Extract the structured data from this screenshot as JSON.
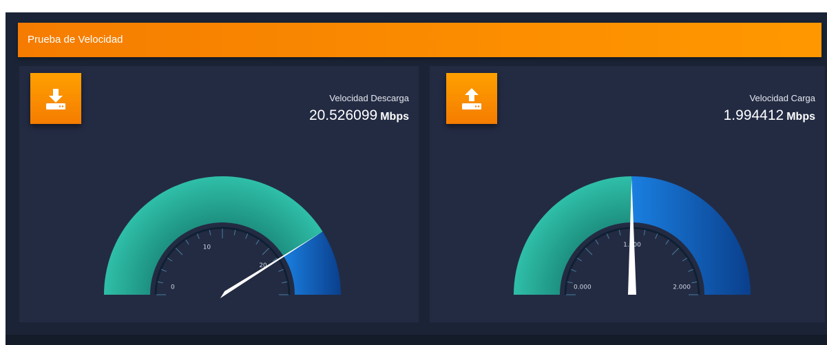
{
  "header": {
    "title": "Prueba de Velocidad"
  },
  "download": {
    "icon": "download-icon",
    "label": "Velocidad Descarga",
    "value": "20.526099",
    "unit": "Mbps",
    "gauge": {
      "min": 0,
      "max": 25,
      "value": 20.526099,
      "tick_labels": [
        "0",
        "10",
        "20"
      ]
    }
  },
  "upload": {
    "icon": "upload-icon",
    "label": "Velocidad Carga",
    "value": "1.994412",
    "unit": "Mbps",
    "gauge": {
      "min": 0,
      "max": 4,
      "value": 1.994412,
      "tick_labels": [
        "0.000",
        "1.000",
        "2.000"
      ]
    }
  },
  "colors": {
    "accent": "#f57c00",
    "gauge_green": "#26a69a",
    "gauge_blue": "#0b63c8",
    "card_bg": "#232b43",
    "page_bg": "#1b2436"
  }
}
